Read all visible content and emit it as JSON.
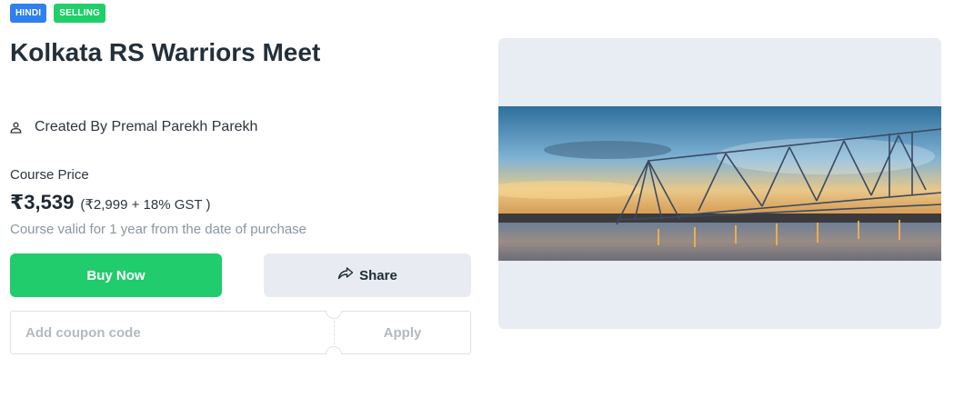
{
  "badges": {
    "language": "HINDI",
    "status": "SELLING"
  },
  "course": {
    "title": "Kolkata RS Warriors Meet",
    "creator": "Created By Premal Parekh Parekh",
    "price_label": "Course Price",
    "price": "₹3,539",
    "price_breakdown": "(₹2,999 + 18% GST )",
    "validity": "Course valid for 1 year from the date of purchase"
  },
  "actions": {
    "buy_label": "Buy Now",
    "share_label": "Share"
  },
  "coupon": {
    "placeholder": "Add coupon code",
    "apply_label": "Apply"
  },
  "colors": {
    "buy": "#20cc6b",
    "badge_language": "#2f80ed",
    "badge_status": "#1fcf6a",
    "media_bg": "#e8ecf3"
  },
  "icons": {
    "creator": "user-icon",
    "share": "share-arrow-icon"
  }
}
